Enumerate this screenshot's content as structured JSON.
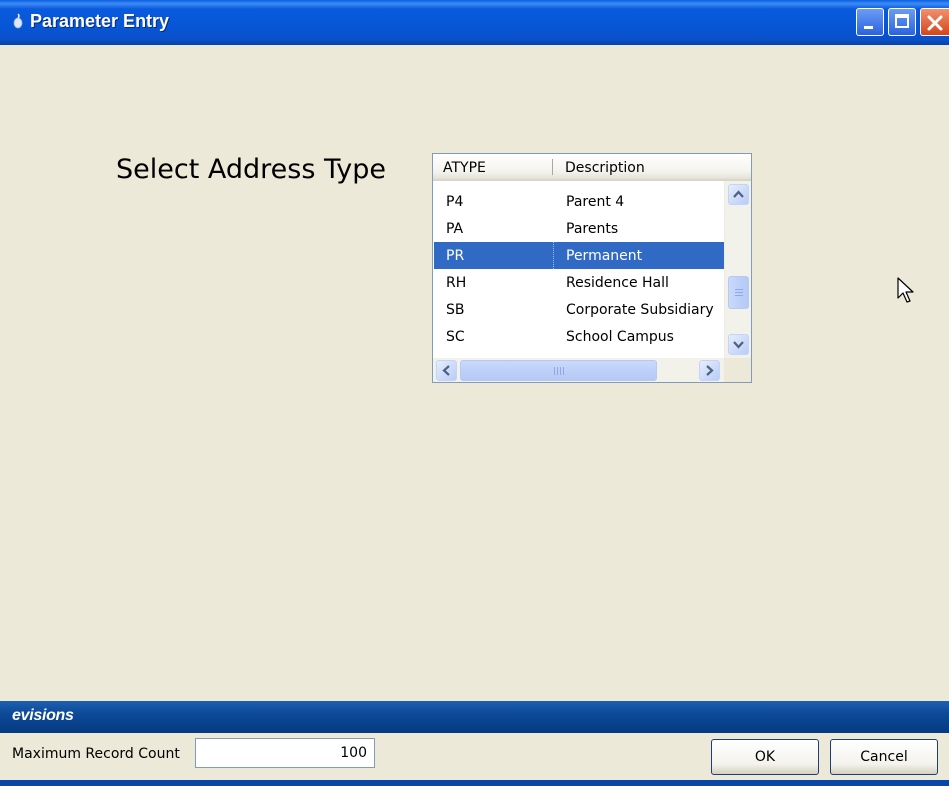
{
  "window": {
    "title": "Parameter Entry"
  },
  "main": {
    "label": "Select Address Type"
  },
  "list": {
    "columns": [
      "ATYPE",
      "Description"
    ],
    "rows": [
      {
        "code": "P4",
        "description": "Parent 4"
      },
      {
        "code": "PA",
        "description": "Parents"
      },
      {
        "code": "PR",
        "description": "Permanent",
        "selected": true
      },
      {
        "code": "RH",
        "description": "Residence Hall"
      },
      {
        "code": "SB",
        "description": "Corporate Subsidiary"
      },
      {
        "code": "SC",
        "description": "School Campus"
      }
    ]
  },
  "brand": {
    "name": "evisions"
  },
  "footer": {
    "max_record_label": "Maximum Record Count",
    "max_record_value": "100",
    "ok_label": "OK",
    "cancel_label": "Cancel"
  },
  "colors": {
    "titlebar": "#0656d6",
    "selection": "#316ac5",
    "background": "#ece9d8",
    "brandbar": "#0d4a98"
  },
  "icons": [
    "app-icon",
    "minimize-icon",
    "maximize-icon",
    "close-icon",
    "scroll-up-icon",
    "scroll-down-icon",
    "scroll-left-icon",
    "scroll-right-icon",
    "mouse-cursor-icon"
  ]
}
